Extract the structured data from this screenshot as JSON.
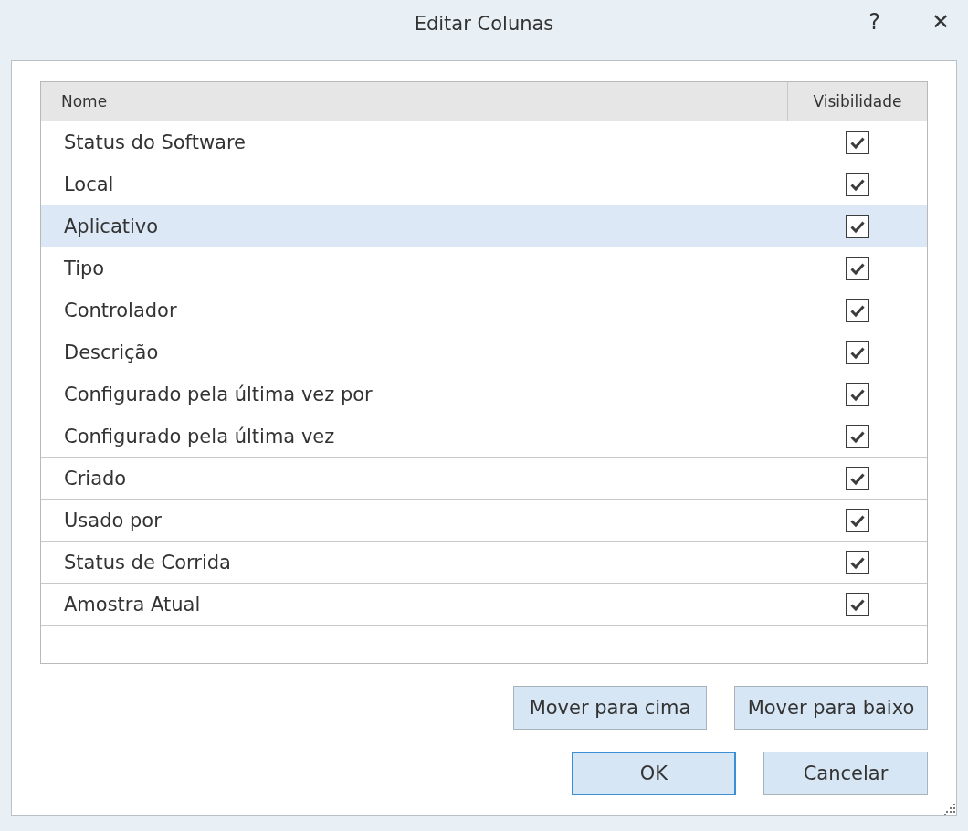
{
  "window": {
    "title": "Editar Colunas",
    "help": "?",
    "close": "✕"
  },
  "table": {
    "columns": [
      "Nome",
      "Visibilidade"
    ],
    "rows": [
      {
        "name": "Status do Software",
        "checked": true,
        "selected": false
      },
      {
        "name": "Local",
        "checked": true,
        "selected": false
      },
      {
        "name": "Aplicativo",
        "checked": true,
        "selected": true
      },
      {
        "name": "Tipo",
        "checked": true,
        "selected": false
      },
      {
        "name": "Controlador",
        "checked": true,
        "selected": false
      },
      {
        "name": "Descrição",
        "checked": true,
        "selected": false
      },
      {
        "name": "Configurado pela última vez por",
        "checked": true,
        "selected": false
      },
      {
        "name": "Configurado pela última vez",
        "checked": true,
        "selected": false
      },
      {
        "name": "Criado",
        "checked": true,
        "selected": false
      },
      {
        "name": "Usado por",
        "checked": true,
        "selected": false
      },
      {
        "name": "Status de Corrida",
        "checked": true,
        "selected": false
      },
      {
        "name": "Amostra Atual",
        "checked": true,
        "selected": false
      }
    ]
  },
  "move_buttons": [
    "Mover para cima",
    "Mover para baixo"
  ],
  "dialog_buttons": [
    {
      "label": "OK",
      "default": true
    },
    {
      "label": "Cancelar",
      "default": false
    }
  ]
}
